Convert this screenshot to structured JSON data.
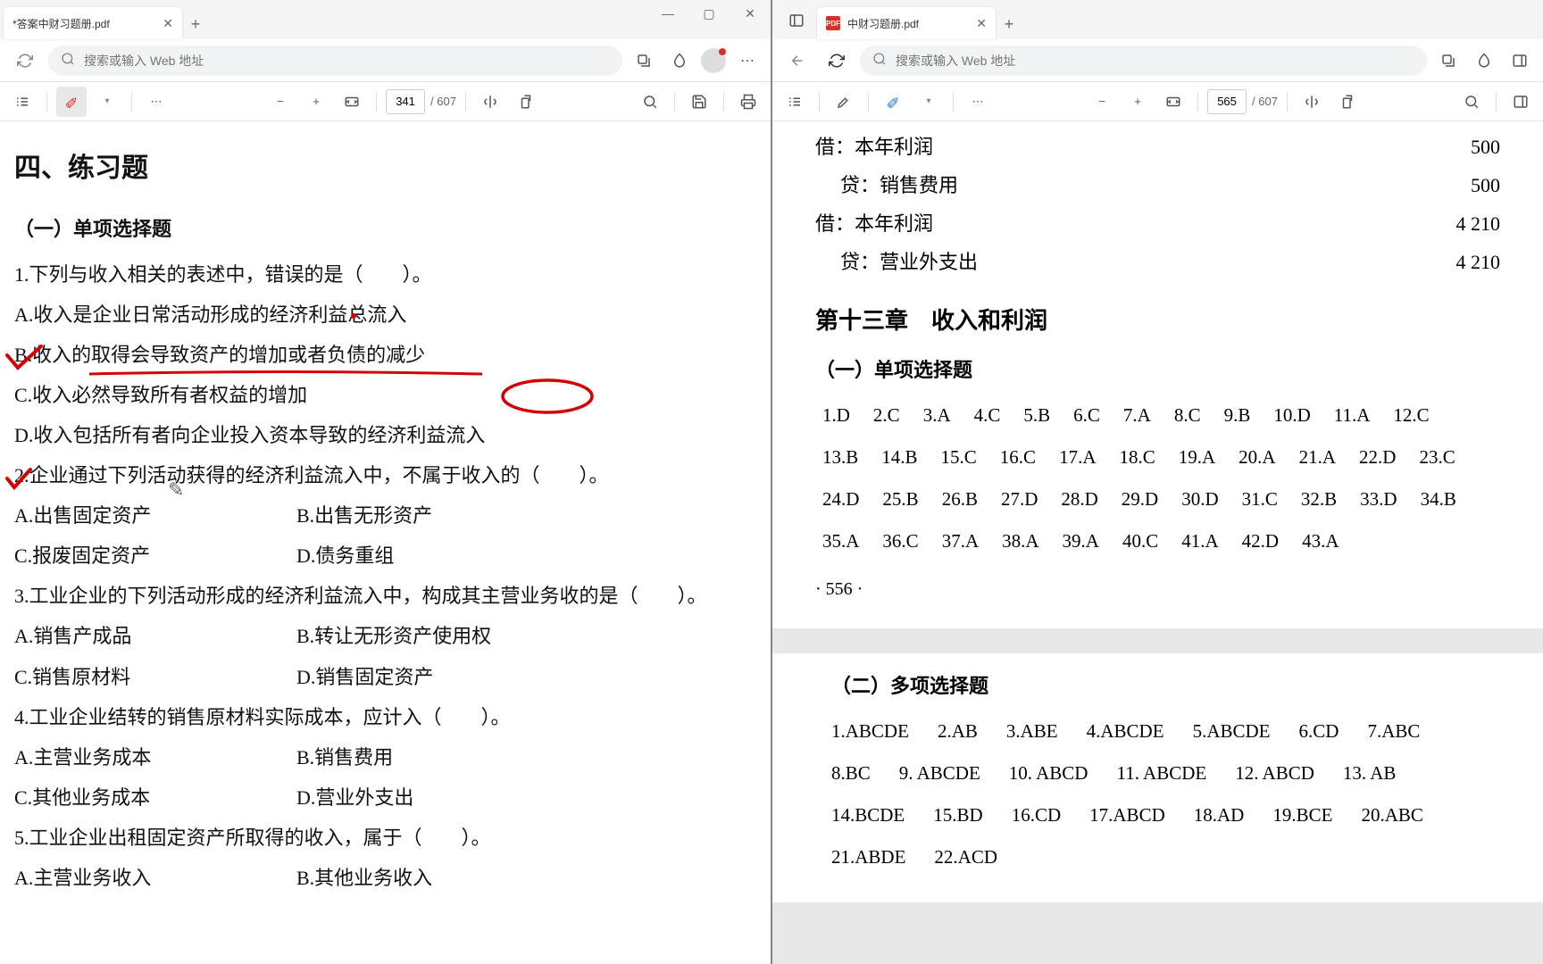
{
  "leftWindow": {
    "tabTitle": "*答案中财习题册.pdf",
    "searchPlaceholder": "搜索或输入 Web 地址",
    "pageCurrent": "341",
    "pageTotal": "/ 607"
  },
  "rightWindow": {
    "tabTitle": "中财习题册.pdf",
    "searchPlaceholder": "搜索或输入 Web 地址",
    "pageCurrent": "565",
    "pageTotal": "/ 607"
  },
  "leftDoc": {
    "sectionTitle": "四、练习题",
    "sub1": "（一）单项选择题",
    "q1": "1.下列与收入相关的表述中，错误的是（　　）。",
    "q1a": "A.收入是企业日常活动形成的经济利益总流入",
    "q1b": "B.收入的取得会导致资产的增加或者负债的减少",
    "q1c": "C.收入必然导致所有者权益的增加",
    "q1d": "D.收入包括所有者向企业投入资本导致的经济利益流入",
    "q2": "2.企业通过下列活动获得的经济利益流入中，不属于收入的（　　）。",
    "q2a": "A.出售固定资产",
    "q2b": "B.出售无形资产",
    "q2c": "C.报废固定资产",
    "q2d": "D.债务重组",
    "q3": "3.工业企业的下列活动形成的经济利益流入中，构成其主营业务收的是（　　）。",
    "q3a": "A.销售产成品",
    "q3b": "B.转让无形资产使用权",
    "q3c": "C.销售原材料",
    "q3d": "D.销售固定资产",
    "q4": "4.工业企业结转的销售原材料实际成本，应计入（　　）。",
    "q4a": "A.主营业务成本",
    "q4b": "B.销售费用",
    "q4c": "C.其他业务成本",
    "q4d": "D.营业外支出",
    "q5": "5.工业企业出租固定资产所取得的收入，属于（　　）。",
    "q5a": "A.主营业务收入",
    "q5b": "B.其他业务收入"
  },
  "rightDoc": {
    "e1l": "借：本年利润",
    "e1r": "500",
    "e2l": "贷：销售费用",
    "e2r": "500",
    "e3l": "借：本年利润",
    "e3r": "4 210",
    "e4l": "贷：营业外支出",
    "e4r": "4 210",
    "chapter": "第十三章　收入和利润",
    "single": "（一）单项选择题",
    "singleAnswers": [
      "1.D",
      "2.C",
      "3.A",
      "4.C",
      "5.B",
      "6.C",
      "7.A",
      "8.C",
      "9.B",
      "10.D",
      "11.A",
      "12.C",
      "13.B",
      "14.B",
      "15.C",
      "16.C",
      "17.A",
      "18.C",
      "19.A",
      "20.A",
      "21.A",
      "22.D",
      "23.C",
      "24.D",
      "25.B",
      "26.B",
      "27.D",
      "28.D",
      "29.D",
      "30.D",
      "31.C",
      "32.B",
      "33.D",
      "34.B",
      "35.A",
      "36.C",
      "37.A",
      "38.A",
      "39.A",
      "40.C",
      "41.A",
      "42.D",
      "43.A"
    ],
    "pageNum": "· 556 ·",
    "multi": "（二）多项选择题",
    "multiAnswers": [
      "1.ABCDE",
      "2.AB",
      "3.ABE",
      "4.ABCDE",
      "5.ABCDE",
      "6.CD",
      "7.ABC",
      "8.BC",
      "9. ABCDE",
      "10. ABCD",
      "11. ABCDE",
      "12. ABCD",
      "13. AB",
      "14.BCDE",
      "15.BD",
      "16.CD",
      "17.ABCD",
      "18.AD",
      "19.BCE",
      "20.ABC",
      "21.ABDE",
      "22.ACD"
    ]
  }
}
